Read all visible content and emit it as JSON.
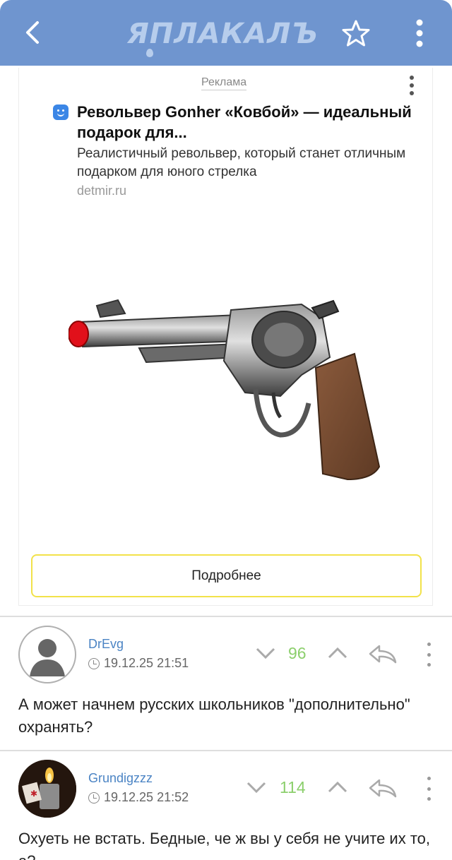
{
  "header": {
    "back_icon": "chevron-left-icon",
    "logo_text": "ЯПЛАКАЛЪ",
    "favorite_icon": "star-icon",
    "menu_icon": "vertical-dots-icon",
    "color": "#6f95cf"
  },
  "ad": {
    "label": "Реклама",
    "title": "Револьвер Gonher «Ковбой» — идеальный подарок для...",
    "description": "Реалистичный револьвер, который станет отличным подарком для юного стрелка",
    "domain": "detmir.ru",
    "image_alt": "revolver-image",
    "button_label": "Подробнее"
  },
  "comments": [
    {
      "user": "DrEvg",
      "time": "19.12.25 21:51",
      "score": "96",
      "text": "А может начнем русских школьников \"дополнительно\" охранять?",
      "avatar": "default-avatar"
    },
    {
      "user": "Grundigzzz",
      "time": "19.12.25 21:52",
      "score": "114",
      "text": "Охуеть не встать. Бедные, че ж вы у себя не учите их то, а?",
      "avatar": "lighter-avatar"
    }
  ]
}
